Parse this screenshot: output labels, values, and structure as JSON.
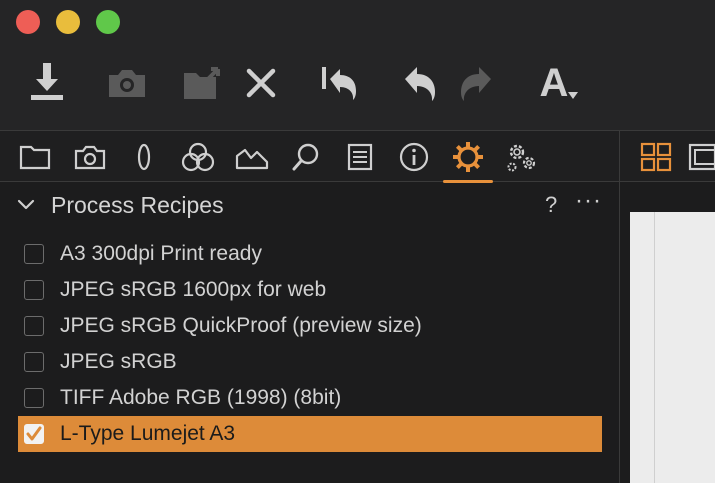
{
  "window": {
    "controls": [
      "close",
      "minimize",
      "zoom"
    ]
  },
  "toolbar": {
    "buttons": [
      {
        "icon": "download-icon",
        "enabled": true
      },
      {
        "icon": "camera-icon",
        "enabled": false
      },
      {
        "icon": "folder-export-icon",
        "enabled": false
      },
      {
        "icon": "close-icon",
        "enabled": true
      },
      {
        "icon": "undo-history-icon",
        "enabled": true
      },
      {
        "icon": "undo-icon",
        "enabled": true
      },
      {
        "icon": "redo-icon",
        "enabled": false
      },
      {
        "icon": "text-tool-icon",
        "enabled": true
      }
    ],
    "text_tool_glyph": "A"
  },
  "tools_tabs": [
    {
      "icon": "folder-icon",
      "active": false
    },
    {
      "icon": "camera-icon",
      "active": false
    },
    {
      "icon": "lens-icon",
      "active": false
    },
    {
      "icon": "color-icon",
      "active": false
    },
    {
      "icon": "exposure-icon",
      "active": false
    },
    {
      "icon": "search-icon",
      "active": false
    },
    {
      "icon": "metadata-icon",
      "active": false
    },
    {
      "icon": "info-icon",
      "active": false
    },
    {
      "icon": "gear-icon",
      "active": true
    },
    {
      "icon": "gears-icon",
      "active": false
    }
  ],
  "panel": {
    "title": "Process Recipes",
    "help": "?",
    "more": "···"
  },
  "recipes": [
    {
      "label": "A3 300dpi Print ready",
      "checked": false,
      "selected": false
    },
    {
      "label": "JPEG sRGB 1600px for web",
      "checked": false,
      "selected": false
    },
    {
      "label": "JPEG sRGB QuickProof (preview size)",
      "checked": false,
      "selected": false
    },
    {
      "label": "JPEG sRGB",
      "checked": false,
      "selected": false
    },
    {
      "label": "TIFF Adobe RGB (1998) (8bit)",
      "checked": false,
      "selected": false
    },
    {
      "label": "L-Type Lumejet A3",
      "checked": true,
      "selected": true
    }
  ],
  "colors": {
    "accent": "#e8913b",
    "selection": "#dd8b39",
    "close": "#ee5e56",
    "minimize": "#e9bd3c",
    "zoom": "#60c84a"
  }
}
